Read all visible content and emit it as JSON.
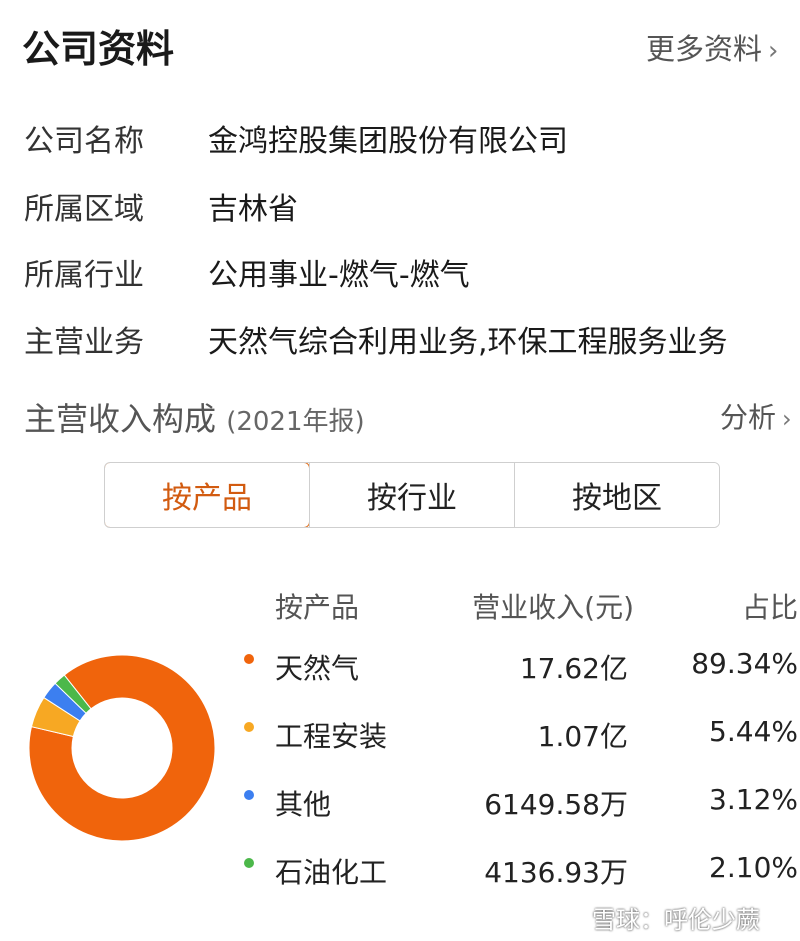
{
  "header": {
    "title": "公司资料",
    "more_label": "更多资料",
    "more_chevron": "›"
  },
  "info": [
    {
      "label": "公司名称",
      "value": "金鸿控股集团股份有限公司"
    },
    {
      "label": "所属区域",
      "value": "吉林省"
    },
    {
      "label": "所属行业",
      "value": "公用事业-燃气-燃气"
    },
    {
      "label": "主营业务",
      "value": "天然气综合利用业务,环保工程服务业务"
    }
  ],
  "revenue": {
    "title": "主营收入构成",
    "year_note": "(2021年报)",
    "analyze_label": "分析",
    "analyze_chevron": "›"
  },
  "tabs": [
    {
      "label": "按产品",
      "active": true
    },
    {
      "label": "按行业",
      "active": false
    },
    {
      "label": "按地区",
      "active": false
    }
  ],
  "table": {
    "headers": [
      "按产品",
      "营业收入(元)",
      "占比"
    ],
    "rows": [
      {
        "name": "天然气",
        "revenue": "17.62亿",
        "share": "89.34%",
        "color": "#f0640c"
      },
      {
        "name": "工程安装",
        "revenue": "1.07亿",
        "share": "5.44%",
        "color": "#f7a823"
      },
      {
        "name": "其他",
        "revenue": "6149.58万",
        "share": "3.12%",
        "color": "#3c7ff0"
      },
      {
        "name": "石油化工",
        "revenue": "4136.93万",
        "share": "2.10%",
        "color": "#4cb84a"
      }
    ]
  },
  "chart_data": {
    "type": "pie",
    "categories": [
      "天然气",
      "工程安装",
      "其他",
      "石油化工"
    ],
    "values": [
      89.34,
      5.44,
      3.12,
      2.1
    ],
    "colors": [
      "#f0640c",
      "#f7a823",
      "#3c7ff0",
      "#4cb84a"
    ]
  },
  "watermark": "雪球：呼伦少蕨"
}
